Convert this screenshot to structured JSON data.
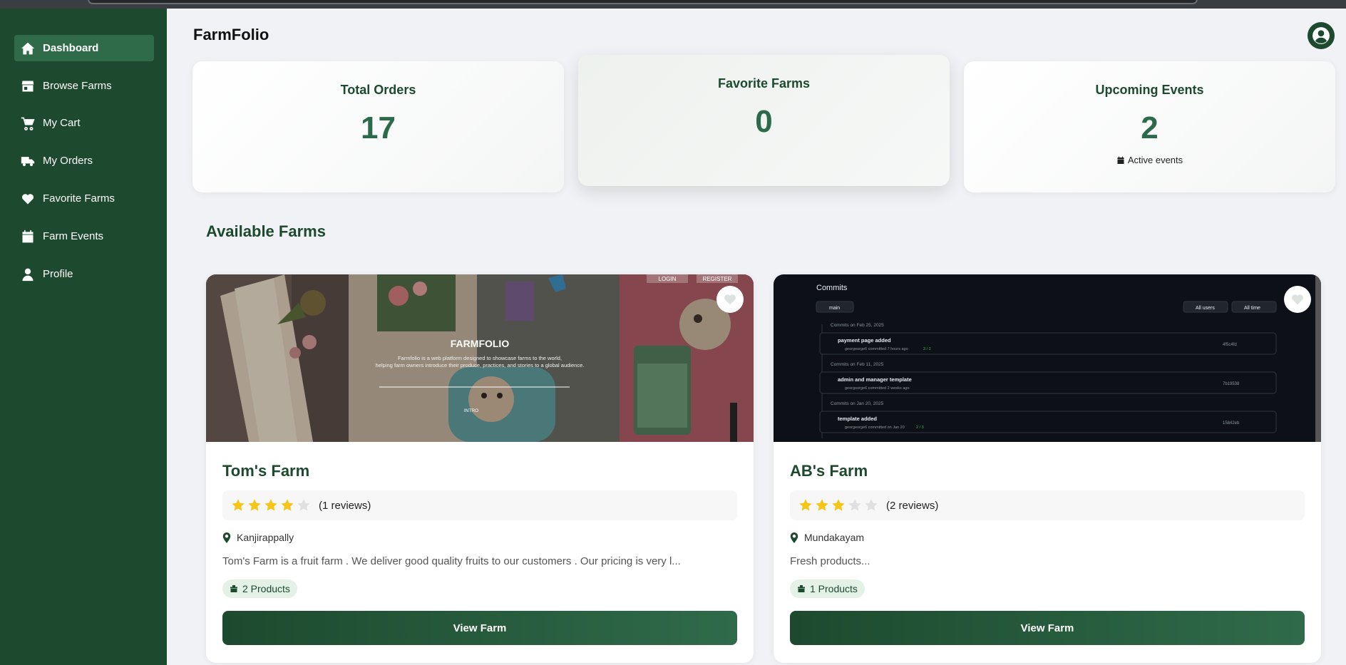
{
  "app": {
    "brand": "FarmFolio"
  },
  "sidebar": {
    "items": [
      {
        "label": "Dashboard",
        "icon": "home-icon",
        "active": true
      },
      {
        "label": "Browse Farms",
        "icon": "store-icon"
      },
      {
        "label": "My Cart",
        "icon": "cart-icon"
      },
      {
        "label": "My Orders",
        "icon": "truck-icon"
      },
      {
        "label": "Favorite Farms",
        "icon": "heart-icon"
      },
      {
        "label": "Farm Events",
        "icon": "calendar-icon"
      },
      {
        "label": "Profile",
        "icon": "user-icon"
      }
    ]
  },
  "stats": [
    {
      "title": "Total Orders",
      "value": "17"
    },
    {
      "title": "Favorite Farms",
      "value": "0"
    },
    {
      "title": "Upcoming Events",
      "value": "2",
      "sub": "Active events"
    }
  ],
  "section": {
    "title": "Available Farms"
  },
  "farms": [
    {
      "name": "Tom's Farm",
      "rating": 4,
      "max_rating": 5,
      "reviews": "(1 reviews)",
      "location": "Kanjirappally",
      "description": "Tom's Farm is a fruit farm . We deliver good quality fruits to our customers . Our pricing is very l...",
      "products": "2 Products",
      "button": "View Farm",
      "image": {
        "heading": "FARMFOLIO",
        "tagline_1": "Farmfolio is a web platform designed to showcase farms to the world,",
        "tagline_2": "helping farm owners introduce their produce, practices, and stories to a global audience.",
        "login": "LOGIN",
        "register": "REGISTER",
        "intro": "INTRO"
      }
    },
    {
      "name": "AB's Farm",
      "rating": 3,
      "max_rating": 5,
      "reviews": "(2 reviews)",
      "location": "Mundakayam",
      "description": "Fresh products...",
      "products": "1 Products",
      "button": "View Farm",
      "image": {
        "heading": "Commits",
        "branch": "main",
        "users": "All users",
        "time": "All time",
        "groups": [
          {
            "date": "Commits on Feb 25, 2025",
            "message": "payment page added",
            "meta": "georgeorge6 committed 7 hours ago",
            "checks": "2 / 2",
            "sha": "4f5c4fd"
          },
          {
            "date": "Commits on Feb 11, 2025",
            "message": "admin and manager template",
            "meta": "georgeorge6 committed 2 weeks ago",
            "checks": "",
            "sha": "7b19538"
          },
          {
            "date": "Commits on Jan 20, 2025",
            "message": "template added",
            "meta": "georgeorge6 committed on Jan 20",
            "checks": "2 / 3",
            "sha": "15842eb"
          }
        ]
      }
    }
  ],
  "colors": {
    "sidebar": "#1d4a2e",
    "accent": "#2f6b48",
    "star": "#f5c518",
    "star_empty": "#e0e0e0"
  }
}
